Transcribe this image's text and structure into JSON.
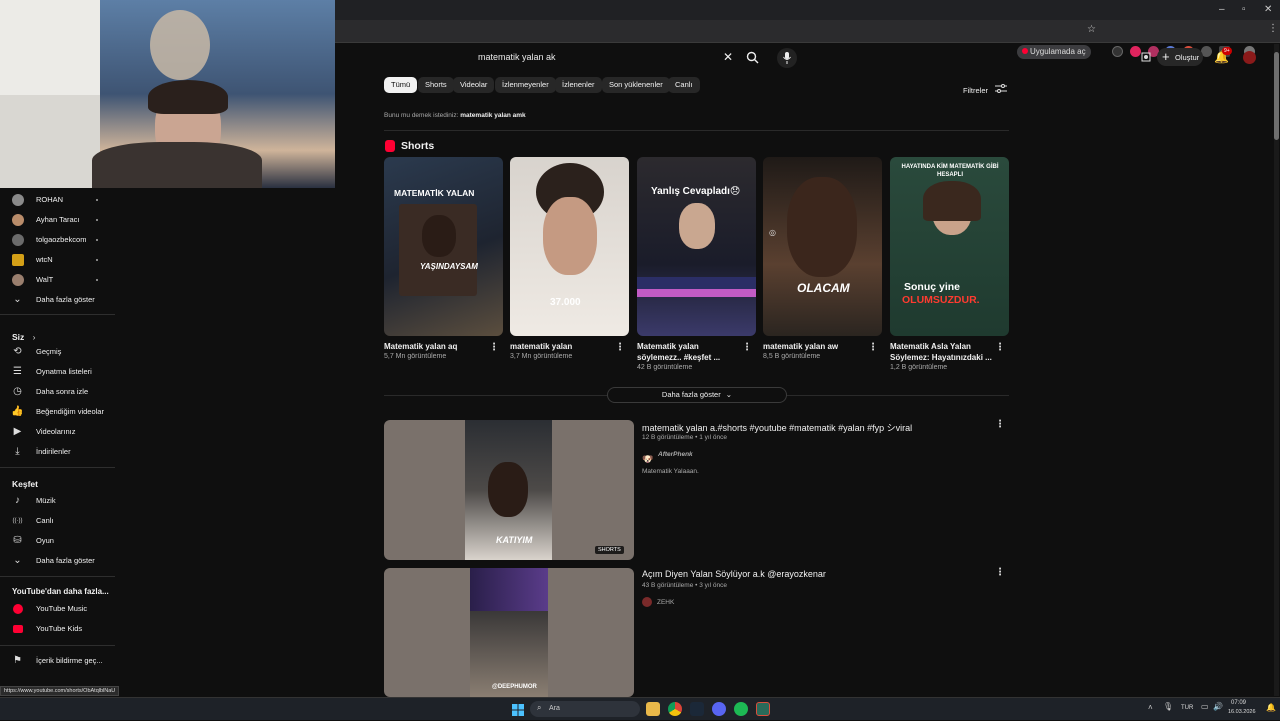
{
  "browser": {
    "open_in_app": "Uygulamada aç",
    "minimize": "–",
    "restore": "▫",
    "close": "✕"
  },
  "header": {
    "search_query": "matematik yalan ak",
    "create_label": "Oluştur",
    "notification_count": "9+"
  },
  "filters_label": "Filtreler",
  "chips": [
    "Tümü",
    "Shorts",
    "Videolar",
    "İzlenmeyenler",
    "İzlenenler",
    "Son yüklenenler",
    "Canlı"
  ],
  "did_you_mean": {
    "prefix": "Bunu mu demek istediniz:",
    "suggestion": "matematik yalan amk"
  },
  "shorts_section": {
    "title": "Shorts",
    "show_more": "Daha fazla göster",
    "items": [
      {
        "title": "Matematik yalan aq",
        "views": "5,7 Mn görüntüleme",
        "overlay_top": "MATEMATİK YALAN",
        "overlay_bottom": "YAŞINDAYSAM"
      },
      {
        "title": "matematik yalan",
        "views": "3,7 Mn görüntüleme",
        "overlay_top": "",
        "overlay_bottom": "37.000"
      },
      {
        "title": "Matematik yalan söylemezz.. #keşfet ...",
        "views": "42 B görüntüleme",
        "overlay_top": "Yanlış Cevapladı😞",
        "overlay_bottom": ""
      },
      {
        "title": "matematik yalan aw",
        "views": "8,5 B görüntüleme",
        "overlay_top": "",
        "overlay_bottom": "OLACAM"
      },
      {
        "title": "Matematik Asla Yalan Söylemez: Hayatınızdaki ...",
        "views": "1,2 B görüntüleme",
        "overlay_top": "HAYATINDA KİM MATEMATİK GİBİ HESAPLI",
        "overlay_bottom_a": "Sonuç yine",
        "overlay_bottom_b": "OLUMSUZDUR."
      }
    ]
  },
  "videos": [
    {
      "title": "matematik yalan a.#shorts #youtube #matematik #yalan #fyp シviral",
      "meta": "12 B görüntüleme • 1 yıl önce",
      "channel": "AfterPhenk",
      "description": "Matematik Yalaaan.",
      "thumb_caption": "KATIYIM",
      "badge": "SHORTS"
    },
    {
      "title": "Açım Diyen Yalan Söylüyor a.k @erayozkenar",
      "meta": "43 B görüntüleme • 3 yıl önce",
      "channel": "ZEHK",
      "description": "",
      "thumb_caption": "@DEEPHUMOR",
      "badge": ""
    }
  ],
  "sidebar": {
    "subscriptions": [
      {
        "name": "ROHAN",
        "color": "#8a8a8a"
      },
      {
        "name": "Ayhan Taracı",
        "color": "#b98c6a"
      },
      {
        "name": "tolgaozbekcom",
        "color": "#6b6b6b"
      },
      {
        "name": "wtcN",
        "color": "#d4a017"
      },
      {
        "name": "WalT",
        "color": "#9a7f6e"
      }
    ],
    "subs_more": "Daha fazla göster",
    "you_header": "Siz",
    "you_items": [
      {
        "label": "Geçmiş",
        "icon": "⟲"
      },
      {
        "label": "Oynatma listeleri",
        "icon": "☰"
      },
      {
        "label": "Daha sonra izle",
        "icon": "◷"
      },
      {
        "label": "Beğendiğim videolar",
        "icon": "👍"
      },
      {
        "label": "Videolarınız",
        "icon": "▶"
      },
      {
        "label": "İndirilenler",
        "icon": "⤓"
      }
    ],
    "explore_header": "Keşfet",
    "explore_items": [
      {
        "label": "Müzik",
        "icon": "♪"
      },
      {
        "label": "Canlı",
        "icon": "((·))"
      },
      {
        "label": "Oyun",
        "icon": "⛁"
      }
    ],
    "explore_more": "Daha fazla göster",
    "more_from_header": "YouTube'dan daha fazla...",
    "more_from_items": [
      "YouTube Music",
      "YouTube Kids"
    ],
    "report": "İçerik bildirme geç..."
  },
  "status_url": "https://www.youtube.com/shorts/ObAtqlblNaU",
  "taskbar": {
    "search_placeholder": "Ara",
    "lang": "TUR",
    "time": "07:09",
    "date": "16.03.2026"
  }
}
